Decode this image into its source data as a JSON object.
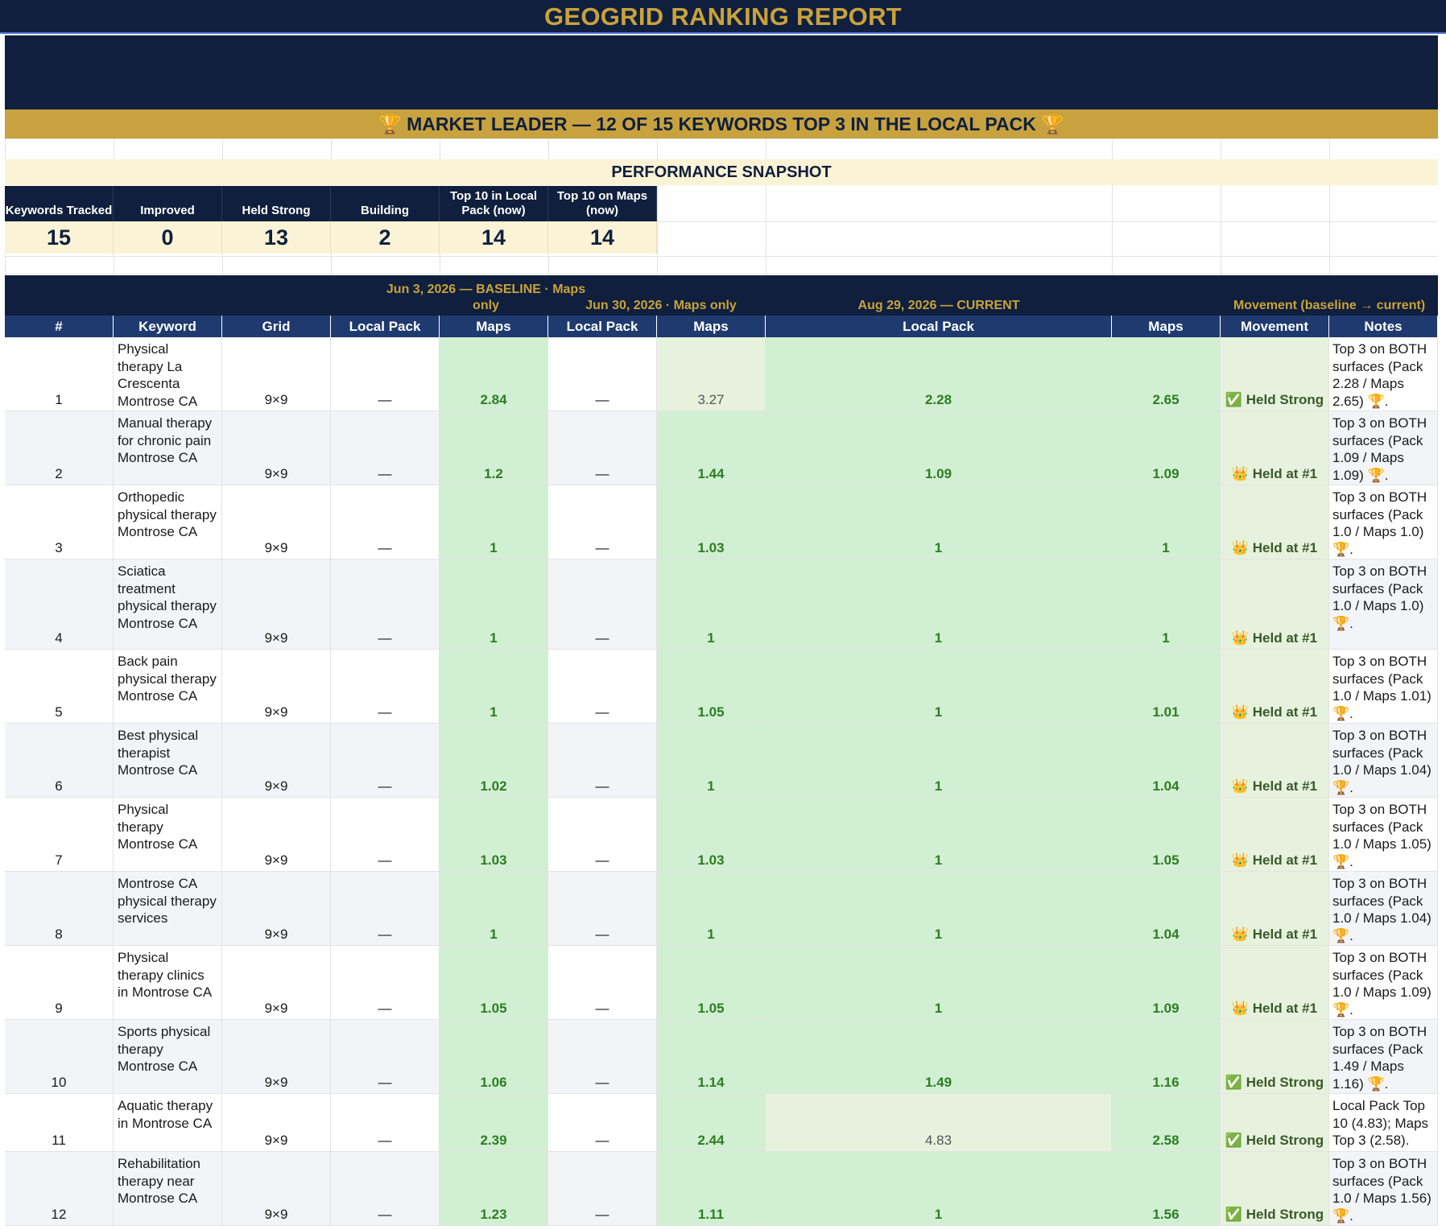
{
  "report": {
    "title": "GEOGRID RANKING REPORT",
    "banner": "🏆  MARKET LEADER — 12 OF 15 KEYWORDS TOP 3 IN THE LOCAL PACK  🏆",
    "snapshot_title": "PERFORMANCE SNAPSHOT"
  },
  "kpis": [
    {
      "label": "Keywords Tracked",
      "value": "15"
    },
    {
      "label": "Improved",
      "value": "0"
    },
    {
      "label": "Held Strong",
      "value": "13"
    },
    {
      "label": "Building",
      "value": "2"
    },
    {
      "label": "Top 10 in Local Pack (now)",
      "value": "14"
    },
    {
      "label": "Top 10 on Maps (now)",
      "value": "14"
    }
  ],
  "periods": [
    {
      "label": "Jun 3, 2026 — BASELINE · Maps only"
    },
    {
      "label": "Jun 30, 2026 · Maps only"
    },
    {
      "label": "Aug 29, 2026 — CURRENT"
    },
    {
      "label": "Movement (baseline → current)"
    }
  ],
  "headers": [
    "#",
    "Keyword",
    "Grid",
    "Local Pack",
    "Maps",
    "Local Pack",
    "Maps",
    "Local Pack",
    "Maps",
    "Movement",
    "Notes"
  ],
  "rows": [
    {
      "num": "1",
      "keyword": "Physical therapy La Crescenta Montrose CA",
      "grid": "9×9",
      "lp1": "—",
      "maps1": "2.84",
      "lp2": "—",
      "maps2": "3.27",
      "lp3": "2.28",
      "maps3": "2.65",
      "movement": "✅ Held Strong",
      "notes": "Top 3 on BOTH surfaces (Pack 2.28 / Maps 2.65) 🏆."
    },
    {
      "num": "2",
      "keyword": "Manual therapy for chronic pain Montrose CA",
      "grid": "9×9",
      "lp1": "—",
      "maps1": "1.2",
      "lp2": "—",
      "maps2": "1.44",
      "lp3": "1.09",
      "maps3": "1.09",
      "movement": "👑 Held at #1",
      "notes": "Top 3 on BOTH surfaces (Pack 1.09 / Maps 1.09) 🏆."
    },
    {
      "num": "3",
      "keyword": "Orthopedic physical therapy Montrose CA",
      "grid": "9×9",
      "lp1": "—",
      "maps1": "1",
      "lp2": "—",
      "maps2": "1.03",
      "lp3": "1",
      "maps3": "1",
      "movement": "👑 Held at #1",
      "notes": "Top 3 on BOTH surfaces (Pack 1.0 / Maps 1.0) 🏆."
    },
    {
      "num": "4",
      "keyword": "Sciatica treatment physical therapy Montrose CA",
      "grid": "9×9",
      "lp1": "—",
      "maps1": "1",
      "lp2": "—",
      "maps2": "1",
      "lp3": "1",
      "maps3": "1",
      "movement": "👑 Held at #1",
      "notes": "Top 3 on BOTH surfaces (Pack 1.0 / Maps 1.0) 🏆."
    },
    {
      "num": "5",
      "keyword": "Back pain physical therapy Montrose CA",
      "grid": "9×9",
      "lp1": "—",
      "maps1": "1",
      "lp2": "—",
      "maps2": "1.05",
      "lp3": "1",
      "maps3": "1.01",
      "movement": "👑 Held at #1",
      "notes": "Top 3 on BOTH surfaces (Pack 1.0 / Maps 1.01) 🏆."
    },
    {
      "num": "6",
      "keyword": "Best physical therapist Montrose CA",
      "grid": "9×9",
      "lp1": "—",
      "maps1": "1.02",
      "lp2": "—",
      "maps2": "1",
      "lp3": "1",
      "maps3": "1.04",
      "movement": "👑 Held at #1",
      "notes": "Top 3 on BOTH surfaces (Pack 1.0 / Maps 1.04) 🏆."
    },
    {
      "num": "7",
      "keyword": "Physical therapy Montrose CA",
      "grid": "9×9",
      "lp1": "—",
      "maps1": "1.03",
      "lp2": "—",
      "maps2": "1.03",
      "lp3": "1",
      "maps3": "1.05",
      "movement": "👑 Held at #1",
      "notes": "Top 3 on BOTH surfaces (Pack 1.0 / Maps 1.05) 🏆."
    },
    {
      "num": "8",
      "keyword": "Montrose CA physical therapy services",
      "grid": "9×9",
      "lp1": "—",
      "maps1": "1",
      "lp2": "—",
      "maps2": "1",
      "lp3": "1",
      "maps3": "1.04",
      "movement": "👑 Held at #1",
      "notes": "Top 3 on BOTH surfaces (Pack 1.0 / Maps 1.04) 🏆."
    },
    {
      "num": "9",
      "keyword": "Physical therapy clinics in Montrose CA",
      "grid": "9×9",
      "lp1": "—",
      "maps1": "1.05",
      "lp2": "—",
      "maps2": "1.05",
      "lp3": "1",
      "maps3": "1.09",
      "movement": "👑 Held at #1",
      "notes": "Top 3 on BOTH surfaces (Pack 1.0 / Maps 1.09) 🏆."
    },
    {
      "num": "10",
      "keyword": "Sports physical therapy Montrose CA",
      "grid": "9×9",
      "lp1": "—",
      "maps1": "1.06",
      "lp2": "—",
      "maps2": "1.14",
      "lp3": "1.49",
      "maps3": "1.16",
      "movement": "✅ Held Strong",
      "notes": "Top 3 on BOTH surfaces (Pack 1.49 / Maps 1.16) 🏆."
    },
    {
      "num": "11",
      "keyword": "Aquatic therapy in Montrose CA",
      "grid": "9×9",
      "lp1": "—",
      "maps1": "2.39",
      "lp2": "—",
      "maps2": "2.44",
      "lp3": "4.83",
      "maps3": "2.58",
      "movement": "✅ Held Strong",
      "notes": "Local Pack Top 10 (4.83); Maps Top 3 (2.58)."
    },
    {
      "num": "12",
      "keyword": "Rehabilitation therapy near Montrose CA",
      "grid": "9×9",
      "lp1": "—",
      "maps1": "1.23",
      "lp2": "—",
      "maps2": "1.11",
      "lp3": "1",
      "maps3": "1.56",
      "movement": "✅ Held Strong",
      "notes": "Top 3 on BOTH surfaces (Pack 1.0 / Maps 1.56) 🏆."
    }
  ]
}
